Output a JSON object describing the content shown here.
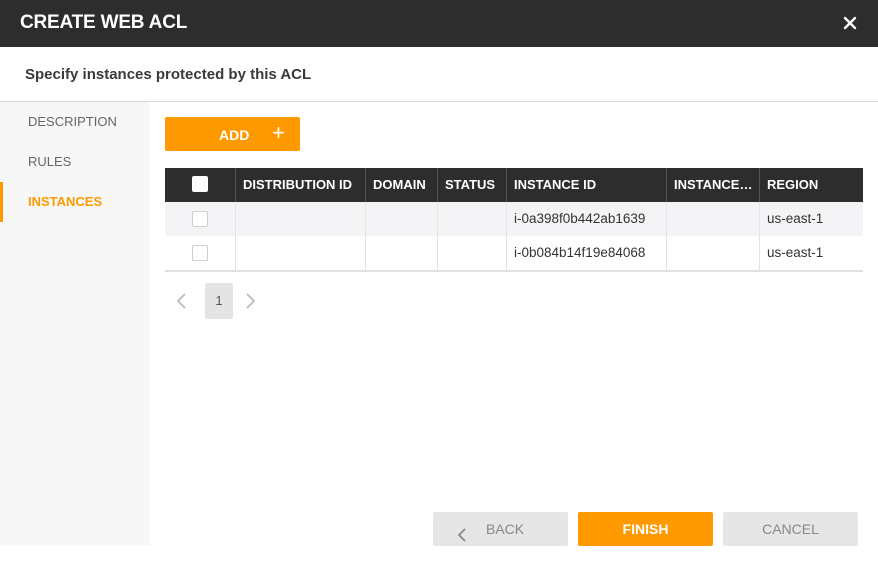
{
  "dialog": {
    "title": "CREATE WEB ACL",
    "subtitle": "Specify instances protected by this ACL"
  },
  "sidebar": {
    "items": [
      {
        "label": "DESCRIPTION",
        "active": false
      },
      {
        "label": "RULES",
        "active": false
      },
      {
        "label": "INSTANCES",
        "active": true
      }
    ]
  },
  "toolbar": {
    "add_label": "ADD",
    "add_icon": "+"
  },
  "table": {
    "columns": [
      "DISTRIBUTION ID",
      "DOMAIN",
      "STATUS",
      "INSTANCE ID",
      "INSTANCE…",
      "REGION"
    ],
    "rows": [
      {
        "distribution_id": "",
        "domain": "",
        "status": "",
        "instance_id": "i-0a398f0b442ab1639",
        "instance_name": "",
        "region": "us-east-1"
      },
      {
        "distribution_id": "",
        "domain": "",
        "status": "",
        "instance_id": "i-0b084b14f19e84068",
        "instance_name": "",
        "region": "us-east-1"
      }
    ]
  },
  "pagination": {
    "current_page": "1"
  },
  "footer": {
    "back_label": "BACK",
    "finish_label": "FINISH",
    "cancel_label": "CANCEL"
  },
  "colors": {
    "accent": "#ff9900",
    "header_bg": "#2d2d2d"
  }
}
